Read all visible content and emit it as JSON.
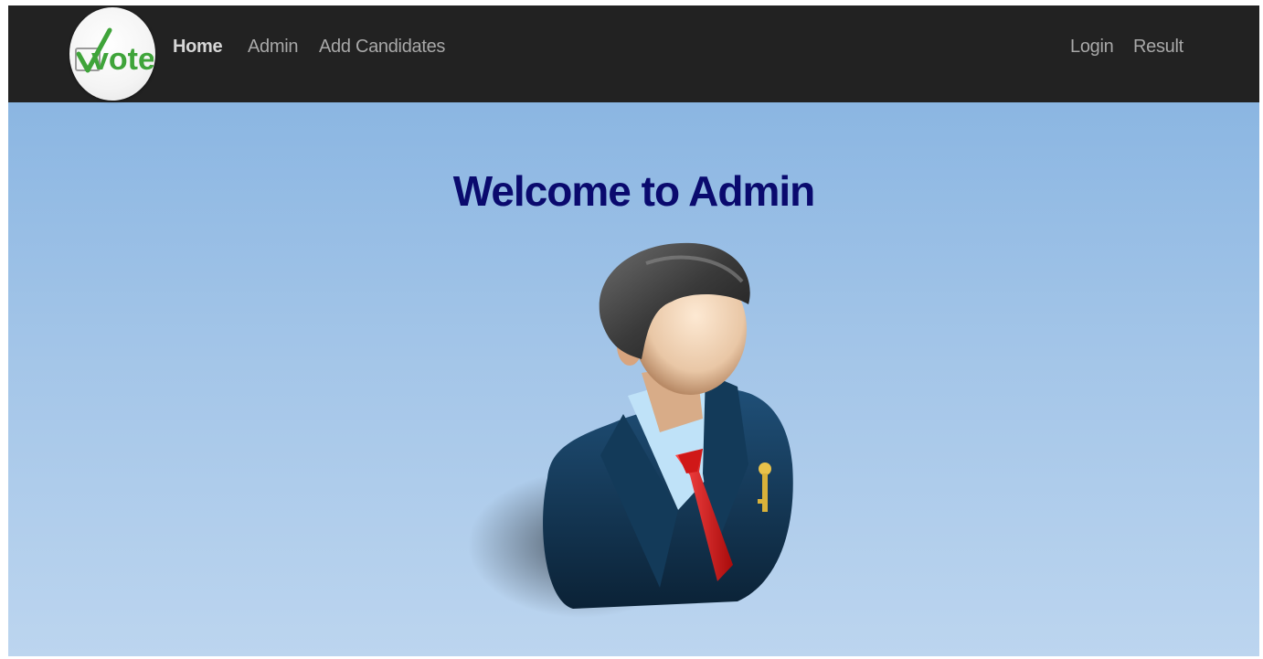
{
  "navbar": {
    "logo_text": "vote",
    "links_left": [
      {
        "label": "Home",
        "active": true
      },
      {
        "label": "Admin",
        "active": false
      },
      {
        "label": "Add Candidates",
        "active": false
      }
    ],
    "links_right": [
      {
        "label": "Login"
      },
      {
        "label": "Result"
      }
    ]
  },
  "hero": {
    "title": "Welcome to Admin",
    "image": "admin-avatar-icon"
  },
  "colors": {
    "navbar_bg": "#222222",
    "title": "#0a0a6e",
    "logo_green": "#3fa43a"
  }
}
